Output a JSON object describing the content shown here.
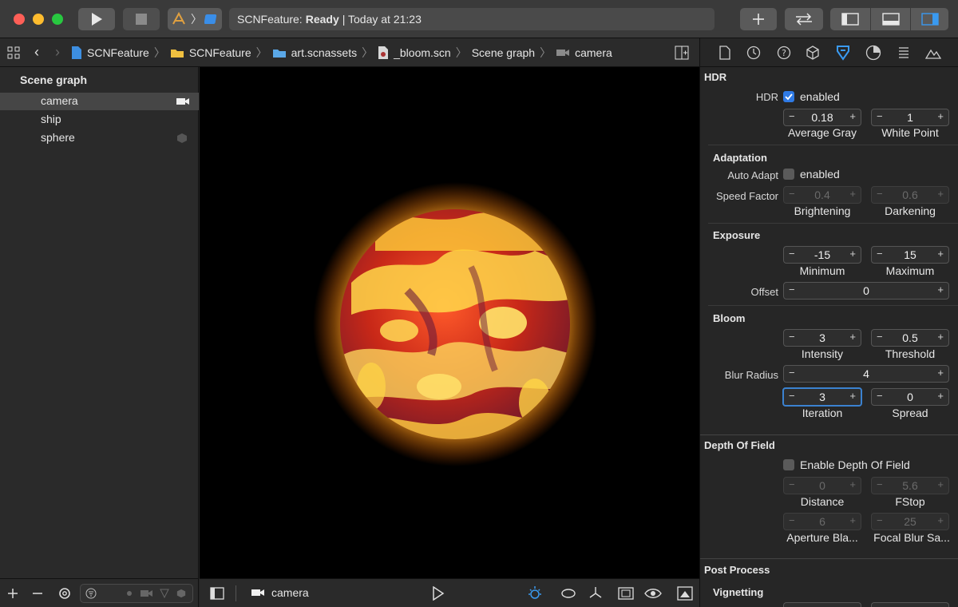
{
  "toolbar": {
    "status_app": "SCNFeature:",
    "status_state": "Ready",
    "status_time": "| Today at 21:23"
  },
  "pathbar": {
    "crumbs": [
      "SCNFeature",
      "SCNFeature",
      "art.scnassets",
      "_bloom.scn",
      "Scene graph",
      "camera"
    ]
  },
  "outline": {
    "title": "Scene graph",
    "items": [
      {
        "label": "camera",
        "selected": true
      },
      {
        "label": "ship",
        "selected": false
      },
      {
        "label": "sphere",
        "selected": false
      }
    ]
  },
  "viewport": {
    "camera_label": "camera"
  },
  "inspector": {
    "hdr": {
      "title": "HDR",
      "hdr_label": "HDR",
      "enabled_label": "enabled",
      "enabled": true,
      "average_gray": "0.18",
      "average_gray_label": "Average Gray",
      "white_point": "1",
      "white_point_label": "White Point"
    },
    "adaptation": {
      "title": "Adaptation",
      "auto_adapt_label": "Auto Adapt",
      "enabled_label": "enabled",
      "enabled": false,
      "speed_factor_label": "Speed Factor",
      "brightening": "0.4",
      "brightening_label": "Brightening",
      "darkening": "0.6",
      "darkening_label": "Darkening"
    },
    "exposure": {
      "title": "Exposure",
      "minimum": "-15",
      "minimum_label": "Minimum",
      "maximum": "15",
      "maximum_label": "Maximum",
      "offset_label": "Offset",
      "offset": "0"
    },
    "bloom": {
      "title": "Bloom",
      "intensity": "3",
      "intensity_label": "Intensity",
      "threshold": "0.5",
      "threshold_label": "Threshold",
      "blur_radius_label": "Blur Radius",
      "blur_radius": "4",
      "iteration": "3",
      "iteration_label": "Iteration",
      "spread": "0",
      "spread_label": "Spread"
    },
    "dof": {
      "title": "Depth Of Field",
      "enable_label": "Enable Depth Of Field",
      "enabled": false,
      "distance": "0",
      "distance_label": "Distance",
      "fstop": "5.6",
      "fstop_label": "FStop",
      "aperture": "6",
      "aperture_label": "Aperture Bla...",
      "focal_blur": "25",
      "focal_blur_label": "Focal Blur Sa..."
    },
    "post": {
      "title": "Post Process",
      "vignetting": "Vignetting"
    }
  },
  "stepper_minus": "−",
  "stepper_plus": "+",
  "colors": {
    "accent": "#2f7ae5",
    "focus": "#3b82d0"
  }
}
